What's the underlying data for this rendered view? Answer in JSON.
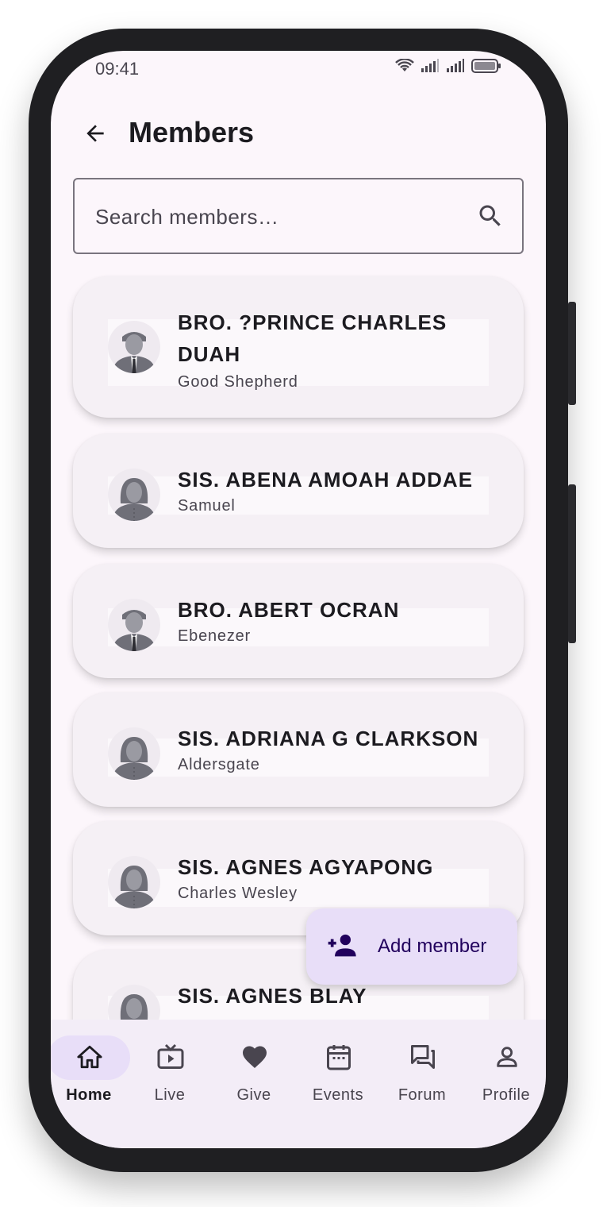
{
  "status_bar": {
    "time": "09:41"
  },
  "header": {
    "title": "Members"
  },
  "search": {
    "placeholder": "Search members…"
  },
  "members": [
    {
      "name": "BRO. ?PRINCE CHARLES DUAH",
      "society": "Good Shepherd",
      "avatar": "male-avatar-icon"
    },
    {
      "name": "SIS. ABENA AMOAH ADDAE",
      "society": "Samuel",
      "avatar": "female-avatar-icon"
    },
    {
      "name": "BRO. ABERT OCRAN",
      "society": "Ebenezer",
      "avatar": "male-avatar-icon"
    },
    {
      "name": "SIS. ADRIANA G CLARKSON",
      "society": "Aldersgate",
      "avatar": "female-avatar-icon"
    },
    {
      "name": "SIS. AGNES AGYAPONG",
      "society": "Charles Wesley",
      "avatar": "female-avatar-icon"
    },
    {
      "name": "SIS. AGNES BLAY",
      "society": "",
      "avatar": "female-avatar-icon"
    }
  ],
  "fab": {
    "label": "Add member",
    "icon": "person-add-icon"
  },
  "nav": [
    {
      "label": "Home",
      "icon": "home-icon",
      "active": true
    },
    {
      "label": "Live",
      "icon": "tv-icon",
      "active": false
    },
    {
      "label": "Give",
      "icon": "heart-icon",
      "active": false
    },
    {
      "label": "Events",
      "icon": "calendar-icon",
      "active": false
    },
    {
      "label": "Forum",
      "icon": "forum-icon",
      "active": false
    },
    {
      "label": "Profile",
      "icon": "person-icon",
      "active": false
    }
  ],
  "colors": {
    "background": "#fcf6fb",
    "card": "#f5f0f5",
    "fab": "#e8def8",
    "fab_text": "#21005d",
    "nav_bg": "#f3edf7",
    "nav_active_pill": "#e8def8"
  }
}
